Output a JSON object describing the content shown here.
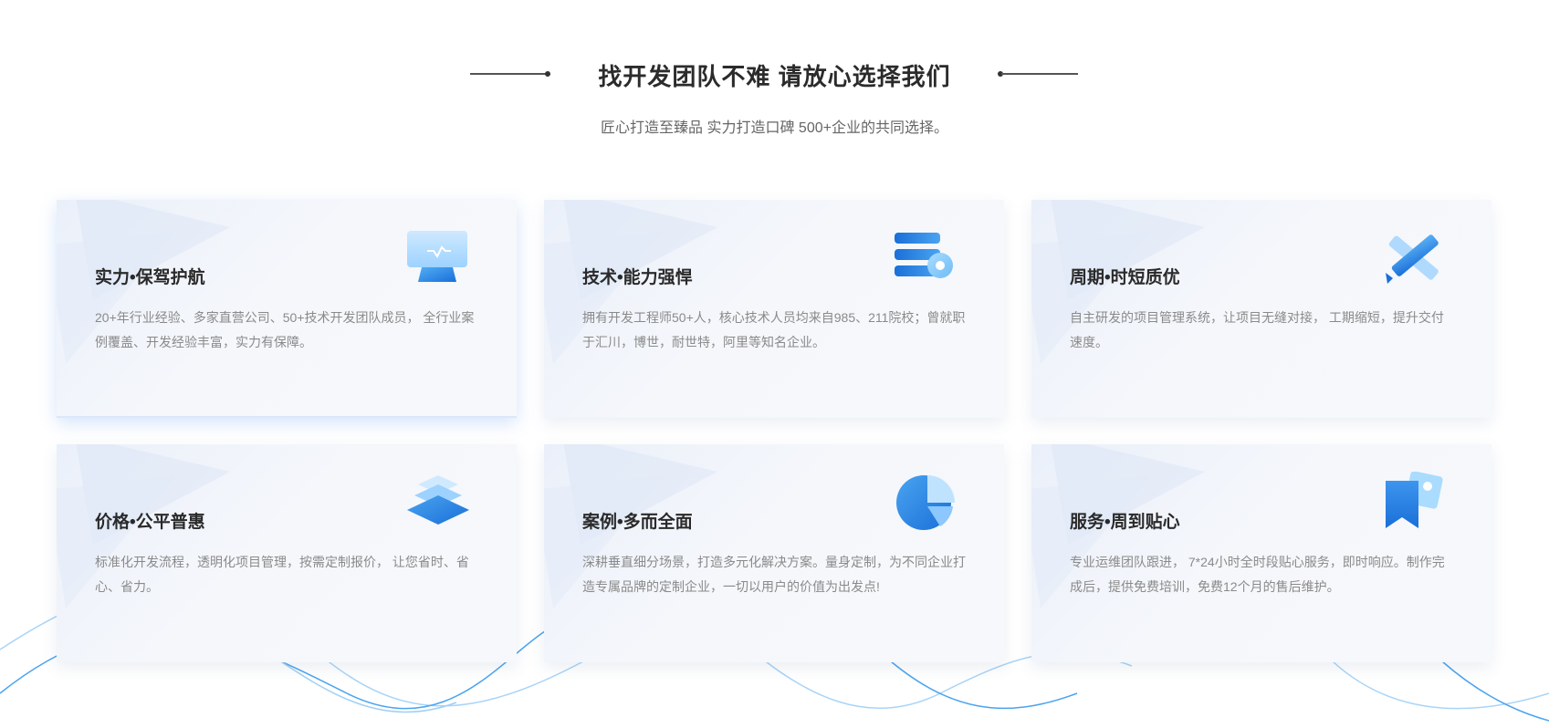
{
  "header": {
    "title": "找开发团队不难 请放心选择我们",
    "subtitle": "匠心打造至臻品 实力打造口碑 500+企业的共同选择。"
  },
  "cards": [
    {
      "title": "实力•保驾护航",
      "desc": "20+年行业经验、多家直营公司、50+技术开发团队成员， 全行业案例覆盖、开发经验丰富，实力有保障。",
      "icon": "monitor-icon"
    },
    {
      "title": "技术•能力强悍",
      "desc": "拥有开发工程师50+人，核心技术人员均来自985、211院校；曾就职于汇川，博世，耐世特，阿里等知名企业。",
      "icon": "server-gear-icon"
    },
    {
      "title": "周期•时短质优",
      "desc": "自主研发的项目管理系统，让项目无缝对接， 工期缩短，提升交付速度。",
      "icon": "pencil-ruler-icon"
    },
    {
      "title": "价格•公平普惠",
      "desc": "标准化开发流程，透明化项目管理，按需定制报价， 让您省时、省心、省力。",
      "icon": "layers-icon"
    },
    {
      "title": "案例•多而全面",
      "desc": "深耕垂直细分场景，打造多元化解决方案。量身定制，为不同企业打造专属品牌的定制企业，一切以用户的价值为出发点!",
      "icon": "pie-chart-icon"
    },
    {
      "title": "服务•周到贴心",
      "desc": "专业运维团队跟进， 7*24小时全时段贴心服务，即时响应。制作完成后，提供免费培训，免费12个月的售后维护。",
      "icon": "bookmark-image-icon"
    }
  ],
  "colors": {
    "accent_blue": "#2f80ed",
    "light_blue": "#8cc7ff",
    "title_text": "#2b2b2b",
    "body_text": "#8a8a8a"
  }
}
